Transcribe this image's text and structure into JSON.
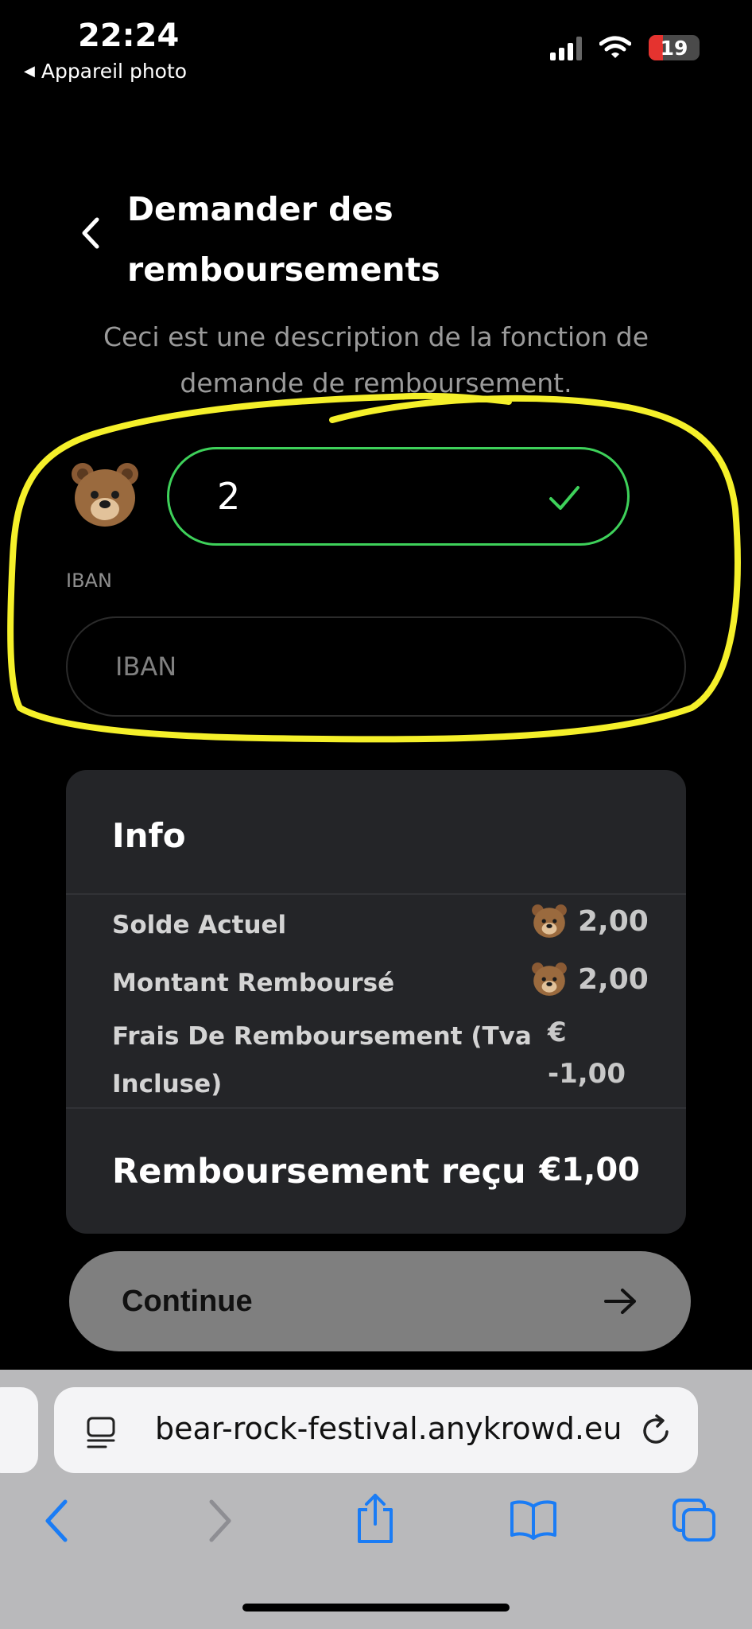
{
  "status_bar": {
    "time": "22:24",
    "back_app": "Appareil photo",
    "battery_level": "19"
  },
  "header": {
    "title_line1": "Demander des",
    "title_line2": "remboursements",
    "back_icon": "chevron-left-icon"
  },
  "description": "Ceci est une description de la fonction de demande de remboursement.",
  "token_field": {
    "icon": "bear-emoji",
    "value": "2",
    "valid": true,
    "border_color": "#3ed15a"
  },
  "iban": {
    "label": "IBAN",
    "placeholder": "IBAN",
    "value": ""
  },
  "info": {
    "title": "Info",
    "rows": [
      {
        "label": "Solde Actuel",
        "value": "2,00",
        "icon": "bear-emoji"
      },
      {
        "label": "Montant Remboursé",
        "value": "2,00",
        "icon": "bear-emoji"
      },
      {
        "label_line1": "Frais De Remboursement (Tva",
        "label_line2": "Incluse)",
        "value_line1": "€",
        "value_line2": "-1,00"
      }
    ],
    "total_label": "Remboursement reçu",
    "total_value": "€1,00"
  },
  "continue_button": {
    "label": "Continue"
  },
  "browser": {
    "url": "bear-rock-festival.anykrowd.eu",
    "accent": "#1a7cf5"
  },
  "annotation": {
    "color": "#f5f02a"
  }
}
